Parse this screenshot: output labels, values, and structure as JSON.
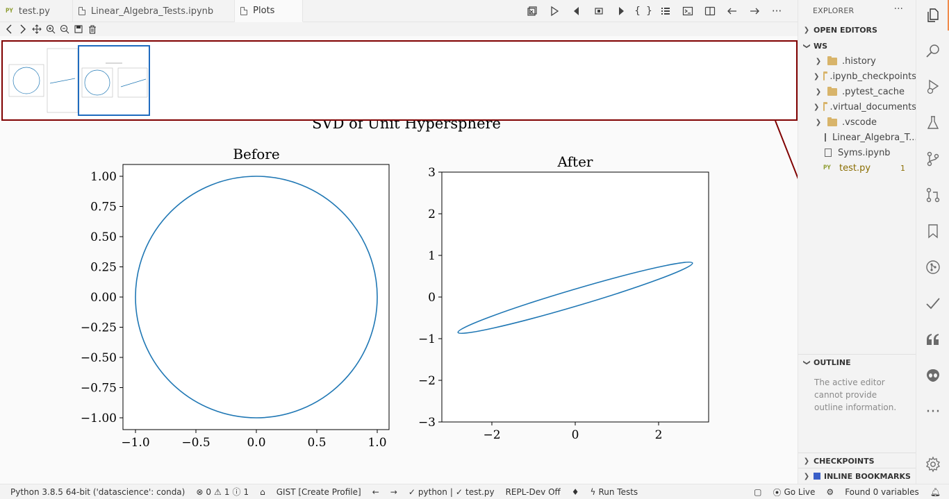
{
  "tabs": [
    {
      "label": "test.py",
      "icon": "python-file-icon",
      "active": false
    },
    {
      "label": "Linear_Algebra_Tests.ipynb",
      "icon": "file-icon",
      "active": false
    },
    {
      "label": "Plots",
      "icon": "file-icon",
      "active": true
    }
  ],
  "editor_actions": [
    "clear-all-icon",
    "run-icon",
    "previous-icon",
    "stop-icon",
    "next-icon",
    "braces-icon",
    "list-icon",
    "terminal-icon",
    "split-editor-icon",
    "go-back-icon",
    "go-forward-icon",
    "more-actions-icon"
  ],
  "plot": {
    "suptitle": "SVD of Unit Hypersphere",
    "before": {
      "title": "Before",
      "yticks": [
        "1.00",
        "0.75",
        "0.50",
        "0.25",
        "0.00",
        "−0.25",
        "−0.50",
        "−0.75",
        "−1.00"
      ],
      "xticks": [
        "−1.0",
        "−0.5",
        "0.0",
        "0.5",
        "1.0"
      ]
    },
    "after": {
      "title": "After",
      "yticks": [
        "3",
        "2",
        "1",
        "0",
        "−1",
        "−2",
        "−3"
      ],
      "xticks": [
        "−2",
        "0",
        "2"
      ]
    },
    "line_color": "#1f77b4"
  },
  "chart_data": [
    {
      "type": "line",
      "title": "Before",
      "description_series": "unit circle",
      "x": [
        1.0,
        0.707,
        0.0,
        -0.707,
        -1.0,
        -0.707,
        0.0,
        0.707,
        1.0
      ],
      "y": [
        0.0,
        0.707,
        1.0,
        0.707,
        0.0,
        -0.707,
        -1.0,
        -0.707,
        0.0
      ],
      "xlim": [
        -1.1,
        1.1
      ],
      "ylim": [
        -1.1,
        1.1
      ]
    },
    {
      "type": "line",
      "title": "After",
      "description_series": "transformed ellipse",
      "x": [
        2.9,
        1.8,
        0.0,
        -1.8,
        -2.85,
        -1.8,
        0.0,
        1.8,
        2.9
      ],
      "y": [
        0.8,
        0.6,
        0.2,
        -0.15,
        -0.8,
        -0.6,
        -0.2,
        0.15,
        0.8
      ],
      "xlim": [
        -3.3,
        3.2
      ],
      "ylim": [
        -3,
        3
      ]
    }
  ],
  "explorer": {
    "title": "EXPLORER",
    "open_editors": "OPEN EDITORS",
    "workspace": "WS",
    "items": [
      {
        "label": ".history",
        "type": "folder"
      },
      {
        "label": ".ipynb_checkpoints",
        "type": "folder"
      },
      {
        "label": ".pytest_cache",
        "type": "folder"
      },
      {
        "label": ".virtual_documents",
        "type": "folder"
      },
      {
        "label": ".vscode",
        "type": "folder"
      },
      {
        "label": "Linear_Algebra_T...",
        "type": "file"
      },
      {
        "label": "Syms.ipynb",
        "type": "file"
      },
      {
        "label": "test.py",
        "type": "python",
        "badge": "1"
      }
    ],
    "outline": "OUTLINE",
    "outline_message": "The active editor cannot provide outline information.",
    "checkpoints": "CHECKPOINTS",
    "inline_bookmarks": "INLINE BOOKMARKS"
  },
  "activity_icons": [
    "explorer-icon",
    "search-icon",
    "run-debug-icon",
    "testing-icon",
    "source-control-icon",
    "pull-request-icon",
    "bookmarks-icon",
    "git-graph-icon",
    "todo-check-icon",
    "quote-icon",
    "alien-icon",
    "more-icon",
    "settings-gear-icon"
  ],
  "status": {
    "interpreter": "Python 3.8.5 64-bit ('datascience': conda)",
    "errors": "0",
    "warnings": "1",
    "infos": "1",
    "gist": "GIST [Create Profile]",
    "python": "python",
    "file": "test.py",
    "repl": "REPL-Dev Off",
    "run_tests": "Run Tests",
    "go_live": "Go Live",
    "variables": "Found 0 variables"
  }
}
